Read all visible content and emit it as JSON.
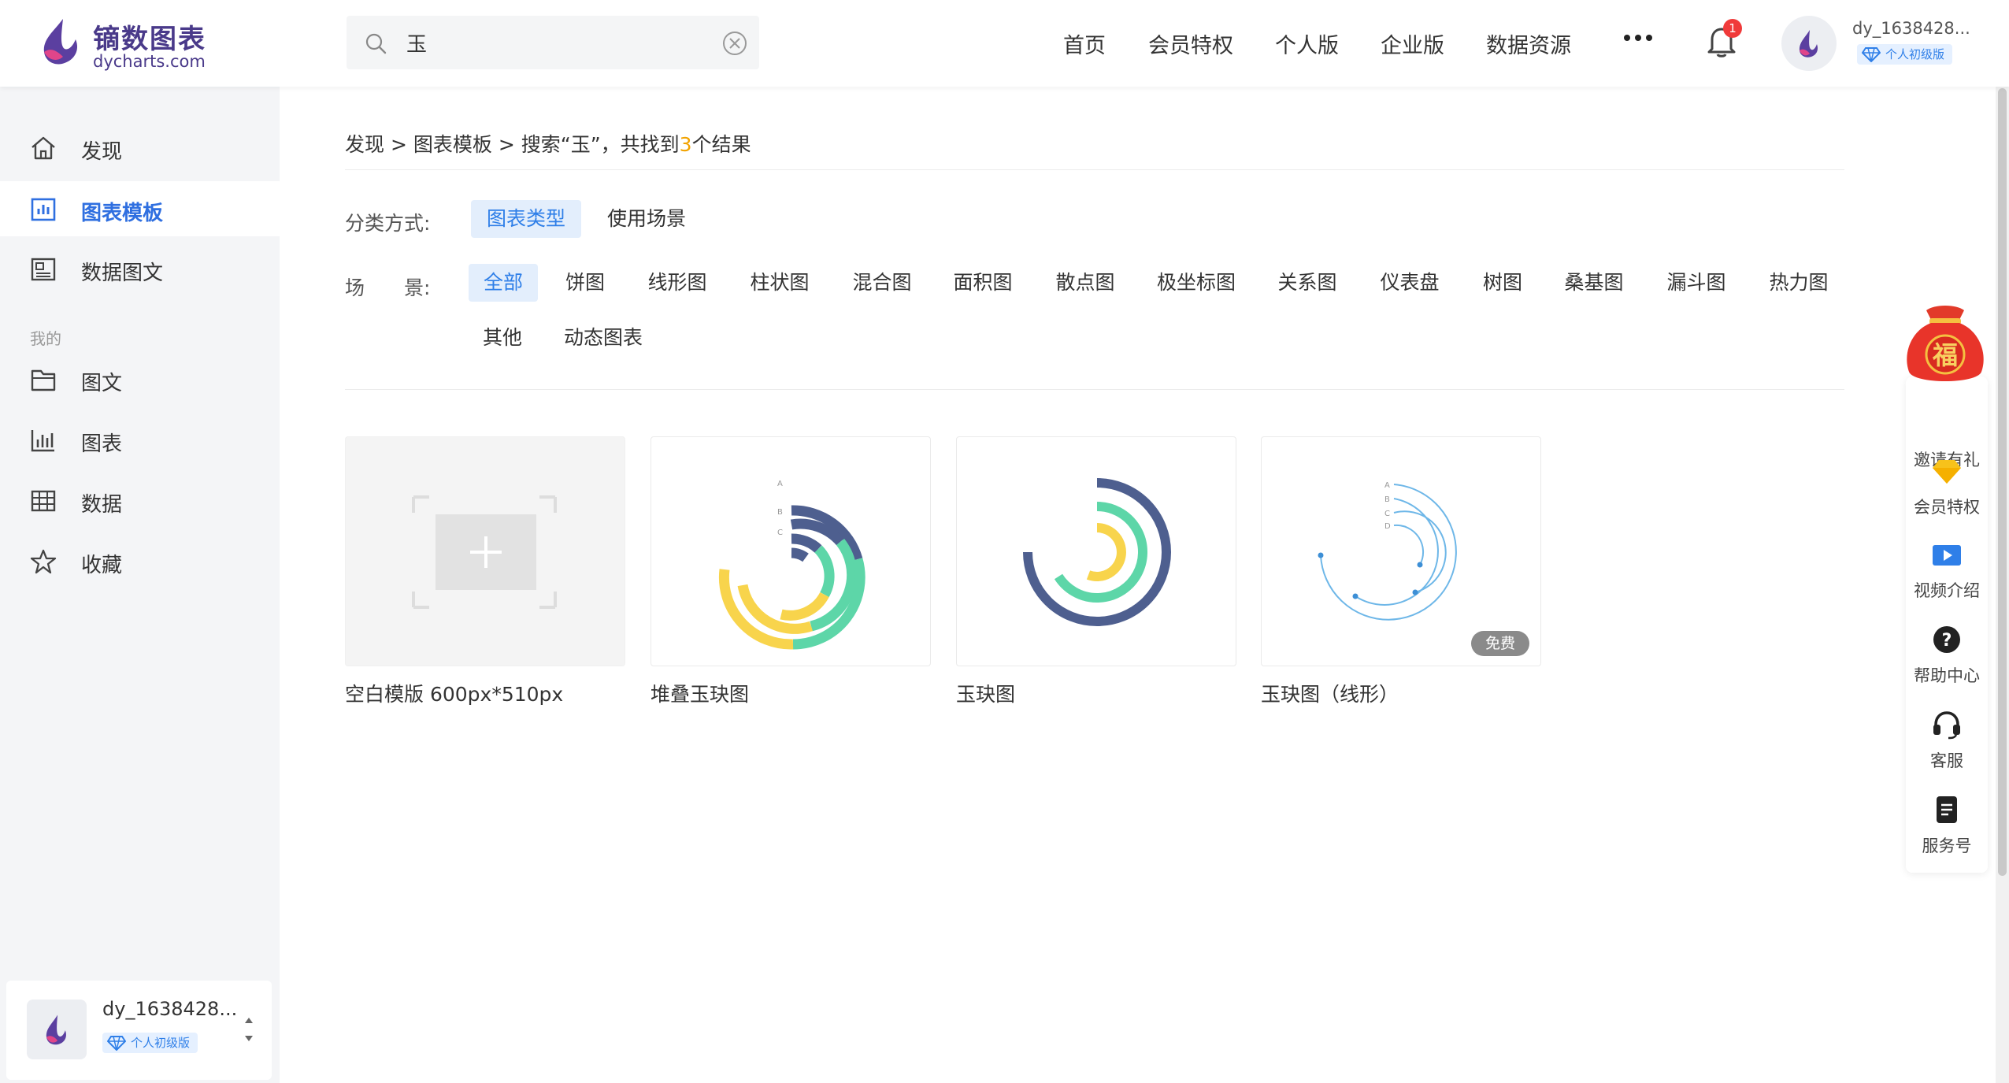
{
  "brand": {
    "name": "镝数图表",
    "domain": "dycharts.com"
  },
  "search": {
    "value": "玉",
    "placeholder": ""
  },
  "topnav": [
    "首页",
    "会员特权",
    "个人版",
    "企业版",
    "数据资源"
  ],
  "notifications": {
    "count": "1"
  },
  "user": {
    "name": "dy_1638428...",
    "tier": "个人初级版"
  },
  "sidebar": {
    "items": [
      {
        "label": "发现",
        "icon": "home-icon"
      },
      {
        "label": "图表模板",
        "icon": "chart-template-icon"
      },
      {
        "label": "数据图文",
        "icon": "article-icon"
      }
    ],
    "section_title": "我的",
    "my_items": [
      {
        "label": "图文",
        "icon": "folder-icon"
      },
      {
        "label": "图表",
        "icon": "bar-chart-icon"
      },
      {
        "label": "数据",
        "icon": "table-icon"
      },
      {
        "label": "收藏",
        "icon": "star-icon"
      }
    ]
  },
  "breadcrumb": {
    "p1": "发现",
    "sep": ">",
    "p2": "图表模板",
    "p3": "搜索“玉”，共找到",
    "count": "3",
    "p4": "个结果"
  },
  "filters": {
    "category_label": "分类方式:",
    "category_options": [
      "图表类型",
      "使用场景"
    ],
    "scene_label": "场　　景:",
    "scene_options": [
      "全部",
      "饼图",
      "线形图",
      "柱状图",
      "混合图",
      "面积图",
      "散点图",
      "极坐标图",
      "关系图",
      "仪表盘",
      "树图",
      "桑基图",
      "漏斗图",
      "热力图",
      "其他",
      "动态图表"
    ]
  },
  "templates": [
    {
      "title": "空白模版 600px*510px"
    },
    {
      "title": "堆叠玉玦图"
    },
    {
      "title": "玉玦图"
    },
    {
      "title": "玉玦图（线形）",
      "badge": "免费"
    }
  ],
  "thumb_labels": {
    "stacked": [
      "A",
      "B",
      "C"
    ],
    "line": [
      "A",
      "B",
      "C",
      "D"
    ]
  },
  "float_panel": [
    {
      "label": "邀请有礼",
      "icon": "fu-bag-icon"
    },
    {
      "label": "会员特权",
      "icon": "diamond-icon"
    },
    {
      "label": "视频介绍",
      "icon": "video-icon"
    },
    {
      "label": "帮助中心",
      "icon": "help-icon"
    },
    {
      "label": "客服",
      "icon": "headset-icon"
    },
    {
      "label": "服务号",
      "icon": "service-account-icon"
    }
  ],
  "fu_char": "福",
  "colors": {
    "accent": "#2f7fe8",
    "navy": "#4e5f8f",
    "green": "#5dd6a8",
    "yellow": "#f8d44c",
    "line_blue": "#6eb7e8"
  }
}
